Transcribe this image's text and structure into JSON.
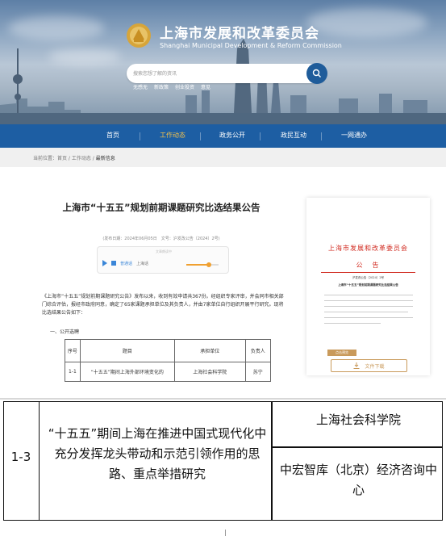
{
  "header": {
    "title": "上海市发展和改革委员会",
    "subtitle": "Shanghai Municipal Development & Reform Commission",
    "search_placeholder": "搜索您想了解的资讯",
    "hot_links": [
      "无感无",
      "新政策",
      "创业投资",
      "意见"
    ]
  },
  "nav": {
    "items": [
      {
        "label": "首页",
        "active": false
      },
      {
        "label": "工作动态",
        "active": true
      },
      {
        "label": "政务公开",
        "active": false
      },
      {
        "label": "政民互动",
        "active": false
      },
      {
        "label": "一网通办",
        "active": false
      }
    ]
  },
  "breadcrumb": {
    "prefix": "当前位置：",
    "path": "首页 / 工作动态 / ",
    "current": "最新信息"
  },
  "article": {
    "title": "上海市“十五五”规划前期课题研究比选结果公告",
    "meta": "(发布日期：2024年06月05日　文号：沪发改公告〔2024〕2号)",
    "audio": {
      "tip": "文章朗读中",
      "voice_label": "普通话",
      "voice_option": "上海话",
      "volume": 0.7
    },
    "intro": "《上海市“十五五”规划前期课题研究公告》发布以来，收到有效申请共367份。经组织专家评审，并会同市相关部门综合评估，报经市政府同意，确定了65家课题承担单位及其负责人，并由7家单位自行组织开展平行研究。现将比选结果公告如下：",
    "section_heading": "一、公开选聘",
    "table": {
      "headers": [
        "序号",
        "题目",
        "承担单位",
        "负责人"
      ],
      "rows": [
        [
          "1-1",
          "“十五五”期间上海外部环境变化的",
          "上海社会科学院",
          "苏宁"
        ]
      ]
    }
  },
  "doc_preview": {
    "org": "上海市发展和改革委员会",
    "heading": "公　告",
    "doc_no": "沪发改公告〔2024〕2号",
    "doc_title": "上海市“十五五”规划前期课题研究比选结果公告",
    "tag": "点击预览",
    "download_label": "文件下载"
  },
  "zoom_table": {
    "number": "1-3",
    "topic": "“十五五”期间上海在推进中国式现代化中充分发挥龙头带动和示范引领作用的思路、重点举措研究",
    "unit1": "上海社会科学院",
    "unit2": "中宏智库（北京）经济咨询中心"
  }
}
